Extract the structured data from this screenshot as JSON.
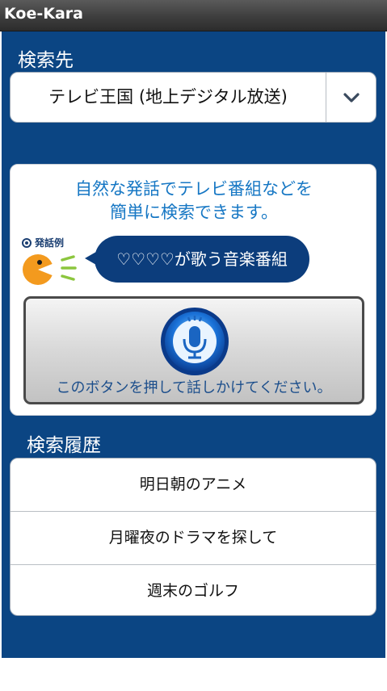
{
  "window": {
    "title": "Koe-Kara"
  },
  "search_target": {
    "label": "検索先",
    "selected": "テレビ王国 (地上デジタル放送)",
    "dropdown_icon": "chevron-down-icon"
  },
  "voice_card": {
    "intro_line1": "自然な発話でテレビ番組などを",
    "intro_line2": "簡単に検索できます。",
    "example_tag": "発話例",
    "example_text": "♡♡♡♡が歌う音楽番組",
    "mic_caption": "このボタンを押して話しかけてください。",
    "mic_icon": "microphone-icon"
  },
  "history": {
    "label": "検索履歴",
    "items": [
      {
        "text": "明日朝のアニメ"
      },
      {
        "text": "月曜夜のドラマを探して"
      },
      {
        "text": "週末のゴルフ"
      }
    ]
  },
  "colors": {
    "background": "#0b4583",
    "accent_text": "#1677c4",
    "bubble": "#0c3d7c"
  }
}
